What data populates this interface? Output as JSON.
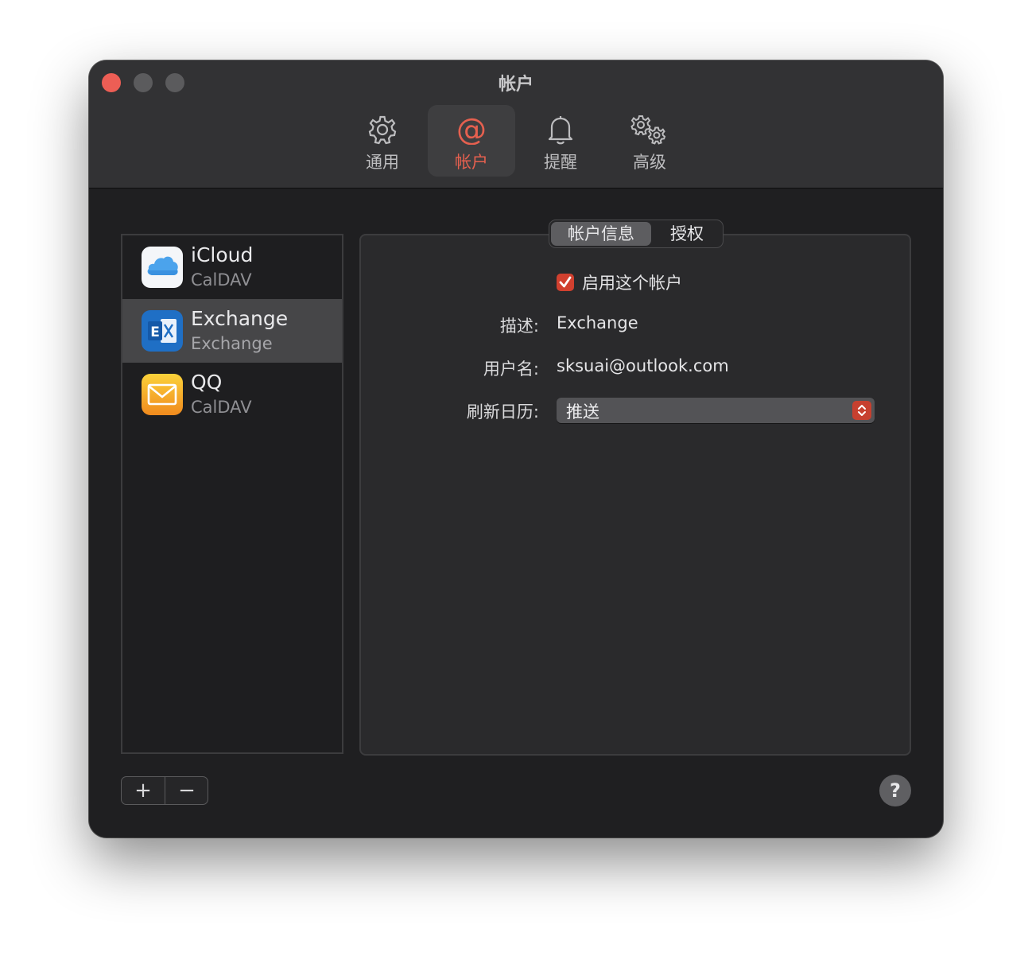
{
  "window": {
    "title": "帐户"
  },
  "toolbar": {
    "items": [
      {
        "label": "通用",
        "icon": "gear-icon",
        "active": false
      },
      {
        "label": "帐户",
        "icon": "at-icon",
        "active": true
      },
      {
        "label": "提醒",
        "icon": "bell-icon",
        "active": false
      },
      {
        "label": "高级",
        "icon": "gears-icon",
        "active": false
      }
    ]
  },
  "accounts": [
    {
      "name": "iCloud",
      "type": "CalDAV",
      "icon": "icloud-icon",
      "selected": false
    },
    {
      "name": "Exchange",
      "type": "Exchange",
      "icon": "exchange-icon",
      "selected": true
    },
    {
      "name": "QQ",
      "type": "CalDAV",
      "icon": "mail-icon",
      "selected": false
    }
  ],
  "tabs": {
    "info": "帐户信息",
    "auth": "授权"
  },
  "form": {
    "enable_label": "启用这个帐户",
    "enable_checked": true,
    "description_label": "描述:",
    "description_value": "Exchange",
    "username_label": "用户名:",
    "username_value": "sksuai@outlook.com",
    "refresh_label": "刷新日历:",
    "refresh_value": "推送"
  },
  "footer": {
    "add": "+",
    "remove": "−",
    "help": "?"
  },
  "colors": {
    "accent": "#e5604f",
    "checkbox": "#d1402f",
    "window_bg": "#1f1f21"
  }
}
